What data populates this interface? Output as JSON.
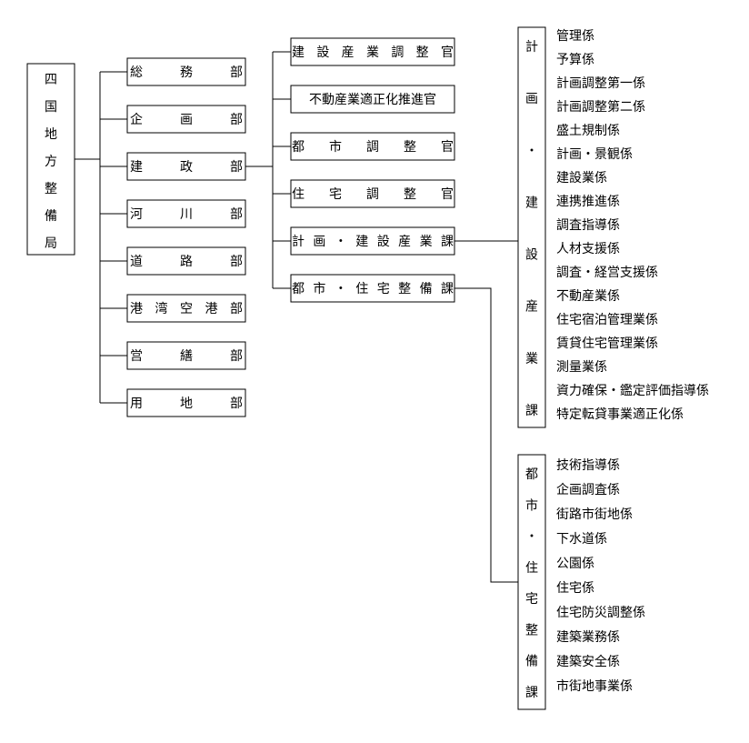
{
  "root": "四国地方整備局",
  "depts": [
    "総務部",
    "企画部",
    "建政部",
    "河川部",
    "道路部",
    "港湾空港部",
    "営繕部",
    "用地部"
  ],
  "sub": [
    "建設産業調整官",
    "不動産業適正化推進官",
    "都市調整官",
    "住宅調整官",
    "計画・建設産業課",
    "都市・住宅整備課"
  ],
  "rightHeaders": [
    "計画・建設産業課",
    "都市・住宅整備課"
  ],
  "listA": [
    "管理係",
    "予算係",
    "計画調整第一係",
    "計画調整第二係",
    "盛土規制係",
    "計画・景観係",
    "建設業係",
    "連携推進係",
    "調査指導係",
    "人材支援係",
    "調査・経営支援係",
    "不動産業係",
    "住宅宿泊管理業係",
    "賃貸住宅管理業係",
    "測量業係",
    "資力確保・鑑定評価指導係",
    "特定転貸事業適正化係"
  ],
  "listB": [
    "技術指導係",
    "企画調査係",
    "街路市街地係",
    "下水道係",
    "公園係",
    "住宅係",
    "住宅防災調整係",
    "建築業務係",
    "建築安全係",
    "市街地事業係"
  ]
}
